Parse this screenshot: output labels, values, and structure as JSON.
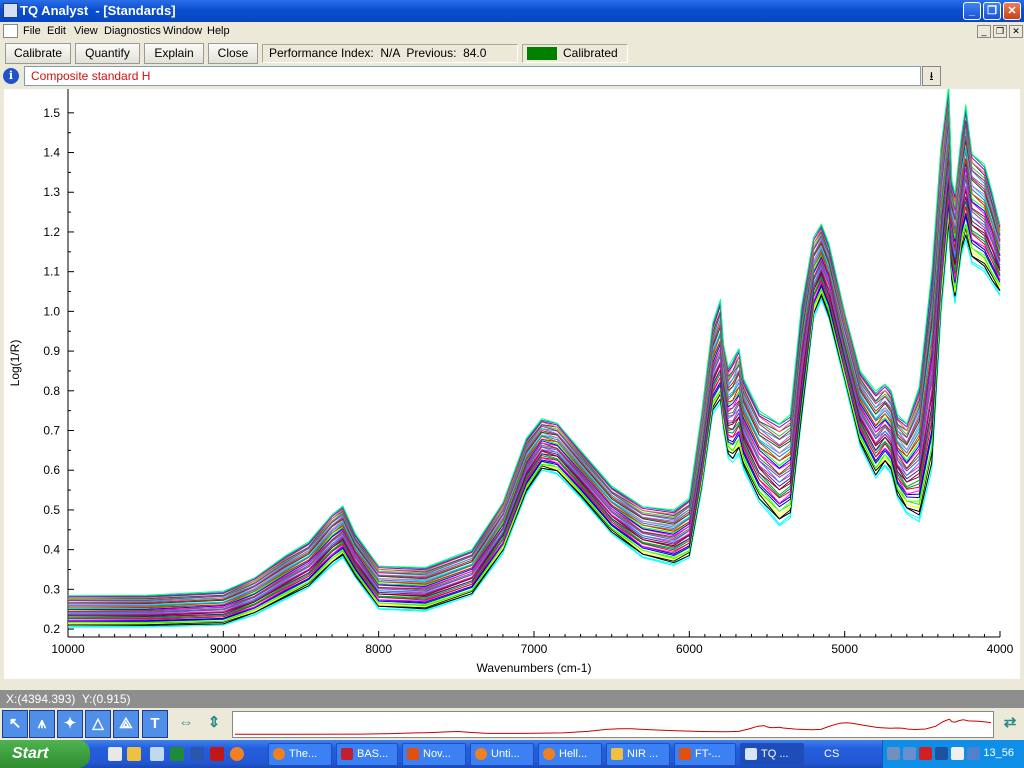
{
  "window": {
    "title": "TQ Analyst  - [Standards]"
  },
  "menu": [
    "File",
    "Edit",
    "View",
    "Diagnostics",
    "Window",
    "Help"
  ],
  "toolbar": {
    "calibrate": "Calibrate",
    "quantify": "Quantify",
    "explain": "Explain",
    "close": "Close",
    "performance_index": "Performance Index:  N/A  Previous:  84.0",
    "status": "Calibrated",
    "status_color": "#008000"
  },
  "standard": {
    "selected": "Composite standard H"
  },
  "chart_data": {
    "type": "line",
    "xlabel": "Wavenumbers (cm-1)",
    "ylabel": "Log(1/R)",
    "xlim": [
      10000,
      4000
    ],
    "ylim": [
      0.18,
      1.56
    ],
    "xticks": [
      "10000",
      "9000",
      "8000",
      "7000",
      "6000",
      "5000",
      "4000"
    ],
    "yticks": [
      "1.5",
      "1.4",
      "1.3",
      "1.2",
      "1.1",
      "1.0",
      "0.9",
      "0.8",
      "0.7",
      "0.6",
      "0.5",
      "0.4",
      "0.3",
      "0.2"
    ],
    "series_count": 40,
    "envelope": {
      "x": [
        10000,
        9500,
        9000,
        8800,
        8600,
        8450,
        8300,
        8230,
        8150,
        8000,
        7700,
        7400,
        7200,
        7050,
        6950,
        6850,
        6700,
        6500,
        6300,
        6100,
        6000,
        5920,
        5850,
        5800,
        5780,
        5750,
        5720,
        5680,
        5650,
        5550,
        5420,
        5350,
        5280,
        5200,
        5150,
        5100,
        5000,
        4900,
        4800,
        4740,
        4700,
        4660,
        4600,
        4520,
        4440,
        4380,
        4330,
        4310,
        4290,
        4250,
        4220,
        4180,
        4100,
        4050,
        4000
      ],
      "upper": [
        0.285,
        0.285,
        0.295,
        0.33,
        0.385,
        0.42,
        0.49,
        0.51,
        0.44,
        0.36,
        0.355,
        0.4,
        0.52,
        0.68,
        0.73,
        0.72,
        0.65,
        0.56,
        0.51,
        0.5,
        0.53,
        0.75,
        0.97,
        1.03,
        0.92,
        0.86,
        0.88,
        0.91,
        0.83,
        0.75,
        0.72,
        0.74,
        1.01,
        1.19,
        1.22,
        1.17,
        1.0,
        0.85,
        0.8,
        0.82,
        0.8,
        0.74,
        0.72,
        0.81,
        1.1,
        1.42,
        1.57,
        1.33,
        1.3,
        1.44,
        1.52,
        1.4,
        1.37,
        1.3,
        1.22
      ],
      "lower": [
        0.205,
        0.205,
        0.21,
        0.235,
        0.275,
        0.305,
        0.36,
        0.38,
        0.33,
        0.25,
        0.245,
        0.285,
        0.39,
        0.54,
        0.6,
        0.59,
        0.53,
        0.44,
        0.38,
        0.36,
        0.38,
        0.55,
        0.74,
        0.77,
        0.7,
        0.63,
        0.62,
        0.64,
        0.6,
        0.52,
        0.46,
        0.48,
        0.72,
        0.98,
        1.03,
        0.98,
        0.82,
        0.66,
        0.58,
        0.61,
        0.59,
        0.53,
        0.49,
        0.47,
        0.6,
        0.99,
        1.21,
        1.07,
        1.02,
        1.14,
        1.18,
        1.12,
        1.1,
        1.07,
        1.04
      ]
    },
    "colors": [
      "#00ffff",
      "#00ffff",
      "#000000",
      "#000000",
      "#ffff00",
      "#00ff00",
      "#66ff00",
      "#0000ff",
      "#0000aa",
      "#ff00ff",
      "#ff0000",
      "#008080",
      "#00aa00",
      "#800080",
      "#8b0000",
      "#333399",
      "#ff1493",
      "#1e90ff",
      "#9932cc",
      "#2e8b57",
      "#b22222",
      "#ff00ff",
      "#0000ff",
      "#00ff00",
      "#ff0000",
      "#808000",
      "#4169e1",
      "#00ced1",
      "#da70d6",
      "#006400",
      "#dc143c",
      "#7b68ee",
      "#20b2aa",
      "#c71585",
      "#32cd32",
      "#483d8b",
      "#ff6347",
      "#9400d3",
      "#008b8b",
      "#00ff7f"
    ]
  },
  "readout": "X:(4394.393)  Y:(0.915)",
  "minimap_color": "#cc0000",
  "taskbar": {
    "start": "Start",
    "tasks": [
      "The...",
      "BAS...",
      "Nov...",
      "Unti...",
      "Hell...",
      "NIR ...",
      "FT-...",
      "TQ ..."
    ],
    "language": "CS",
    "clock": "13_56"
  }
}
